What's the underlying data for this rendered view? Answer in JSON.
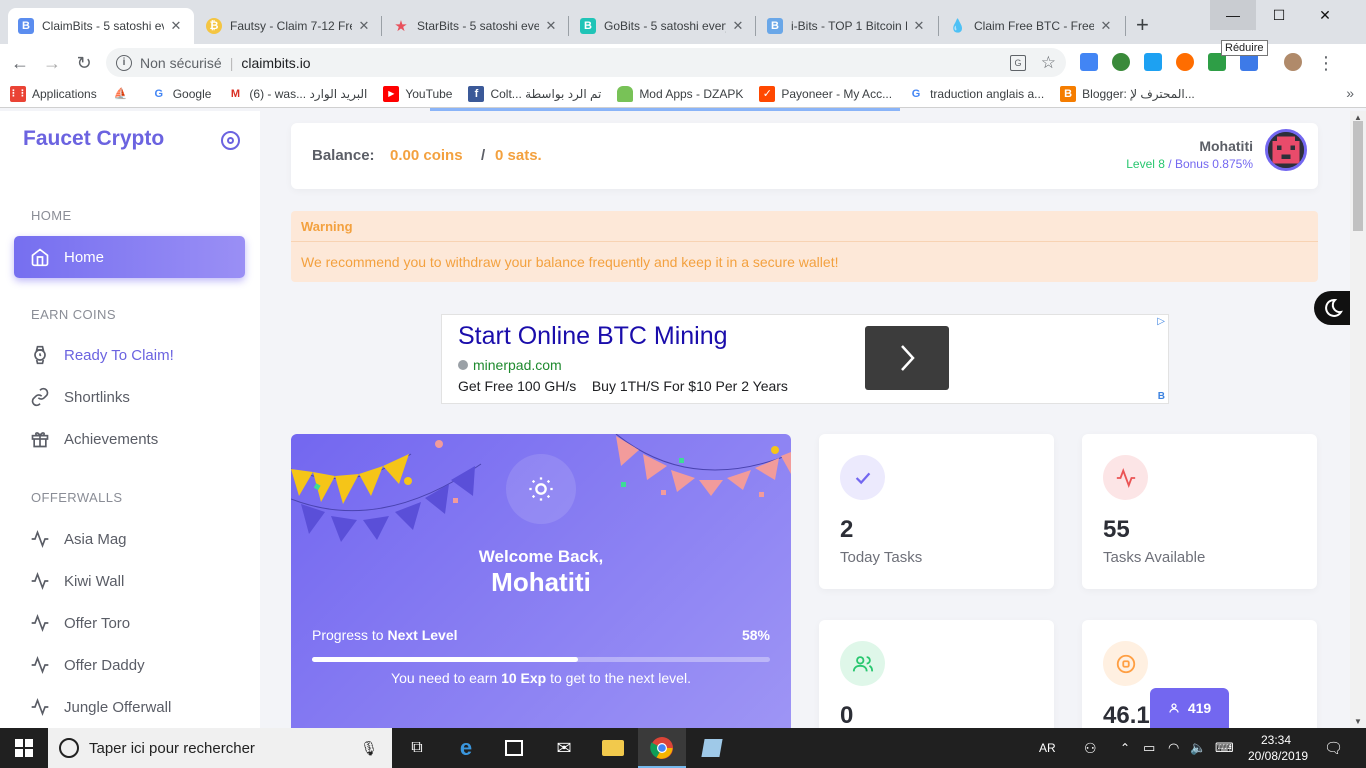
{
  "browser": {
    "tabs": [
      {
        "title": "ClaimBits - 5 satoshi ev",
        "favicon": "B",
        "favicon_color": "#5b8def",
        "active": true
      },
      {
        "title": "Fautsy - Claim 7-12 Fre",
        "favicon": "₿",
        "favicon_color": "#f4c542",
        "active": false
      },
      {
        "title": "StarBits - 5 satoshi eve",
        "favicon": "★",
        "favicon_color": "#e8505b",
        "active": false
      },
      {
        "title": "GoBits - 5 satoshi every",
        "favicon": "B",
        "favicon_color": "#20c4b7",
        "active": false
      },
      {
        "title": "i-Bits - TOP 1 Bitcoin Fa",
        "favicon": "B",
        "favicon_color": "#6aa7e8",
        "active": false
      },
      {
        "title": "Claim Free BTC - Free B",
        "favicon": "💧",
        "favicon_color": "#1e88e5",
        "active": false
      }
    ],
    "new_tab": "+",
    "tooltip": "Réduire",
    "security_label": "Non sécurisé",
    "url": "claimbits.io",
    "bookmarks": [
      {
        "label": "Applications",
        "icon": "apps-grid-icon",
        "color": "#ea4335"
      },
      {
        "label": "",
        "icon": "boat-icon",
        "color": "#d9534f"
      },
      {
        "label": "Google",
        "icon": "google-icon",
        "color": "#4285f4"
      },
      {
        "label": "(6) - was... البريد الوارد",
        "icon": "gmail-icon",
        "color": "#d93025"
      },
      {
        "label": "YouTube",
        "icon": "youtube-icon",
        "color": "#ff0000"
      },
      {
        "label": "Colt... تم الرد بواسطة",
        "icon": "facebook-icon",
        "color": "#3b5998"
      },
      {
        "label": "Mod Apps - DZAPK",
        "icon": "android-icon",
        "color": "#78c257"
      },
      {
        "label": "Payoneer - My Acc...",
        "icon": "payoneer-icon",
        "color": "#ff4800"
      },
      {
        "label": "traduction anglais a...",
        "icon": "google-icon",
        "color": "#4285f4"
      },
      {
        "label": "Blogger: المحترف لإ...",
        "icon": "blogger-icon",
        "color": "#f57d00"
      }
    ],
    "bookmarks_more": "»"
  },
  "sidebar": {
    "brand": "Faucet Crypto",
    "sections": {
      "home": "HOME",
      "earn": "EARN COINS",
      "offerwalls": "OFFERWALLS"
    },
    "items": {
      "home": "Home",
      "ready": "Ready To Claim!",
      "shortlinks": "Shortlinks",
      "achievements": "Achievements",
      "asia": "Asia Mag",
      "kiwi": "Kiwi Wall",
      "toro": "Offer Toro",
      "daddy": "Offer Daddy",
      "jungle": "Jungle Offerwall"
    }
  },
  "header": {
    "balance_label": "Balance:",
    "coins": "0.00 coins",
    "separator": "/",
    "sats": "0 sats.",
    "username": "Mohatiti",
    "level": "Level 8",
    "level_sep": " / ",
    "bonus": "Bonus 0.875%",
    "colors": {
      "accent": "#7367f0",
      "orange": "#f3a13f",
      "green": "#28c76f"
    }
  },
  "warning": {
    "title": "Warning",
    "text": "We recommend you to withdraw your balance frequently and keep it in a secure wallet!"
  },
  "ad": {
    "title": "Start Online BTC Mining",
    "url": "minerpad.com",
    "desc": "Get Free 100 GH/s    Buy 1TH/S For $10 Per 2 Years"
  },
  "hero": {
    "welcome": "Welcome Back,",
    "name": "Mohatiti",
    "progress_label": "Progress to",
    "progress_target": "Next Level",
    "progress_percent": "58%",
    "progress_value": 0.58,
    "msg_pre": "You need to earn",
    "msg_amount": "10 Exp",
    "msg_post": "to get to the next level."
  },
  "stats": [
    {
      "value": "2",
      "label": "Today Tasks",
      "icon": "check-icon",
      "color": "#7367f0",
      "bg": "#eceafd"
    },
    {
      "value": "55",
      "label": "Tasks Available",
      "icon": "activity-icon",
      "color": "#ea5455",
      "bg": "#fce5e6"
    },
    {
      "value": "0",
      "label": "",
      "icon": "users-icon",
      "color": "#28c76f",
      "bg": "#dff7e9"
    },
    {
      "value": "46.1",
      "label": "",
      "icon": "target-icon",
      "color": "#ff9f43",
      "bg": "#fff0e1"
    }
  ],
  "online": {
    "count": "419",
    "icon": "user-icon"
  },
  "taskbar": {
    "search_placeholder": "Taper ici pour rechercher",
    "lang": "AR",
    "time": "23:34",
    "date": "20/08/2019"
  }
}
